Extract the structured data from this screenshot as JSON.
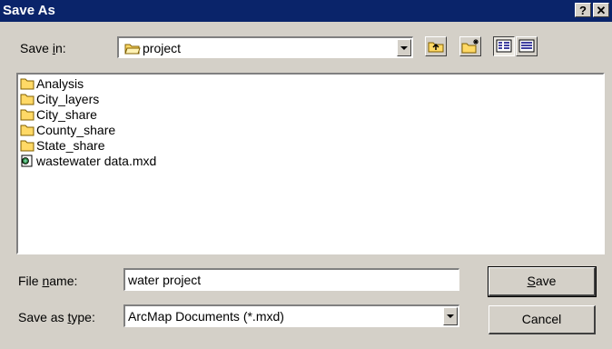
{
  "window": {
    "title": "Save As",
    "help_label": "?",
    "close_label": "✕"
  },
  "save_in": {
    "label_pre": "Save ",
    "label_key": "i",
    "label_post": "n:",
    "value": "project"
  },
  "toolbar": {
    "buttons": [
      {
        "name": "up-one-level",
        "icon": "folder-up-icon"
      },
      {
        "name": "create-new-folder",
        "icon": "new-folder-icon"
      },
      {
        "name": "list-view",
        "icon": "list-view-icon"
      },
      {
        "name": "details-view",
        "icon": "details-view-icon"
      }
    ]
  },
  "files": [
    {
      "label": "Analysis",
      "type": "folder"
    },
    {
      "label": "City_layers",
      "type": "folder"
    },
    {
      "label": "City_share",
      "type": "folder"
    },
    {
      "label": "County_share",
      "type": "folder"
    },
    {
      "label": "State_share",
      "type": "folder"
    },
    {
      "label": "wastewater data.mxd",
      "type": "mxd-document"
    }
  ],
  "file_name": {
    "label_pre": "File ",
    "label_key": "n",
    "label_post": "ame:",
    "value": "water project"
  },
  "save_as_type": {
    "label_pre": "Save as ",
    "label_key": "t",
    "label_post": "ype:",
    "value": "ArcMap Documents (*.mxd)"
  },
  "buttons": {
    "save_key": "S",
    "save_rest": "ave",
    "cancel": "Cancel"
  },
  "colors": {
    "titlebar": "#0a246a",
    "face": "#d4d0c8",
    "folder": "#ffd966"
  }
}
